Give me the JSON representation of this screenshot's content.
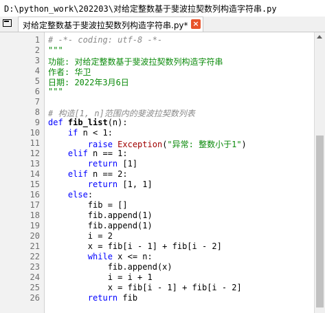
{
  "window": {
    "title": "D:\\python_work\\202203\\对给定整数基于斐波拉契数列构造字符串.py"
  },
  "tab": {
    "label": "对给定整数基于斐波拉契数列构造字符串.py*",
    "close_glyph": "×"
  },
  "editor": {
    "lines": [
      {
        "n": "1",
        "parts": [
          {
            "t": "# -*- coding: utf-8 -*-",
            "k": "c"
          }
        ]
      },
      {
        "n": "2",
        "parts": [
          {
            "t": "\"\"\"",
            "k": "s"
          }
        ]
      },
      {
        "n": "3",
        "parts": [
          {
            "t": "功能: 对给定整数基于斐波拉契数列构造字符串",
            "k": "s"
          }
        ]
      },
      {
        "n": "4",
        "parts": [
          {
            "t": "作者: 华卫",
            "k": "s"
          }
        ]
      },
      {
        "n": "5",
        "parts": [
          {
            "t": "日期: 2022年3月6日",
            "k": "s"
          }
        ]
      },
      {
        "n": "6",
        "parts": [
          {
            "t": "\"\"\"",
            "k": "s"
          }
        ]
      },
      {
        "n": "7",
        "parts": []
      },
      {
        "n": "8",
        "parts": [
          {
            "t": "# 构造[1, n]范围内的斐波拉契数列表",
            "k": "c"
          }
        ]
      },
      {
        "n": "9",
        "parts": [
          {
            "t": "def ",
            "k": "k"
          },
          {
            "t": "fib_list",
            "k": "f"
          },
          {
            "t": "(n):",
            "k": "p"
          }
        ]
      },
      {
        "n": "10",
        "parts": [
          {
            "t": "    "
          },
          {
            "t": "if",
            "k": "k"
          },
          {
            "t": " n < 1:",
            "k": "p"
          }
        ]
      },
      {
        "n": "11",
        "parts": [
          {
            "t": "        "
          },
          {
            "t": "raise ",
            "k": "k"
          },
          {
            "t": "Exception",
            "k": "e"
          },
          {
            "t": "(",
            "k": "p"
          },
          {
            "t": "\"异常: 整数小于1\"",
            "k": "s"
          },
          {
            "t": ")",
            "k": "p"
          }
        ]
      },
      {
        "n": "12",
        "parts": [
          {
            "t": "    "
          },
          {
            "t": "elif",
            "k": "k"
          },
          {
            "t": " n == 1:",
            "k": "p"
          }
        ]
      },
      {
        "n": "13",
        "parts": [
          {
            "t": "        "
          },
          {
            "t": "return",
            "k": "k"
          },
          {
            "t": " [1]",
            "k": "p"
          }
        ]
      },
      {
        "n": "14",
        "parts": [
          {
            "t": "    "
          },
          {
            "t": "elif",
            "k": "k"
          },
          {
            "t": " n == 2:",
            "k": "p"
          }
        ]
      },
      {
        "n": "15",
        "parts": [
          {
            "t": "        "
          },
          {
            "t": "return",
            "k": "k"
          },
          {
            "t": " [1, 1]",
            "k": "p"
          }
        ]
      },
      {
        "n": "16",
        "parts": [
          {
            "t": "    "
          },
          {
            "t": "else",
            "k": "k"
          },
          {
            "t": ":",
            "k": "p"
          }
        ]
      },
      {
        "n": "17",
        "parts": [
          {
            "t": "        fib = []",
            "k": "p"
          }
        ]
      },
      {
        "n": "18",
        "parts": [
          {
            "t": "        fib.append(1)",
            "k": "p"
          }
        ]
      },
      {
        "n": "19",
        "parts": [
          {
            "t": "        fib.append(1)",
            "k": "p"
          }
        ]
      },
      {
        "n": "20",
        "parts": [
          {
            "t": "        i = 2",
            "k": "p"
          }
        ]
      },
      {
        "n": "21",
        "parts": [
          {
            "t": "        x = fib[i - 1] + fib[i - 2]",
            "k": "p"
          }
        ]
      },
      {
        "n": "22",
        "parts": [
          {
            "t": "        "
          },
          {
            "t": "while",
            "k": "k"
          },
          {
            "t": " x <= n:",
            "k": "p"
          }
        ]
      },
      {
        "n": "23",
        "parts": [
          {
            "t": "            fib.append(x)",
            "k": "p"
          }
        ]
      },
      {
        "n": "24",
        "parts": [
          {
            "t": "            i = i + 1",
            "k": "p"
          }
        ]
      },
      {
        "n": "25",
        "parts": [
          {
            "t": "            x = fib[i - 1] + fib[i - 2]",
            "k": "p"
          }
        ]
      },
      {
        "n": "26",
        "parts": [
          {
            "t": "        "
          },
          {
            "t": "return",
            "k": "k"
          },
          {
            "t": " fib",
            "k": "p"
          }
        ]
      }
    ]
  }
}
